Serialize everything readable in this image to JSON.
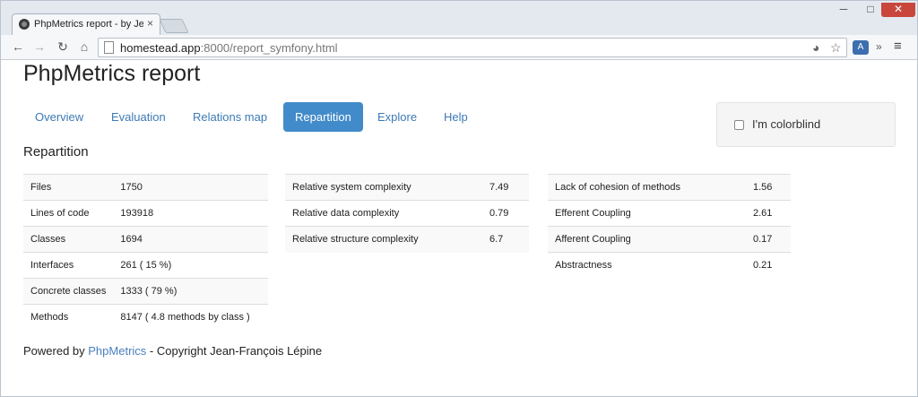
{
  "browser": {
    "tab_title": "PhpMetrics report - by Jean",
    "tab_close": "×",
    "url_host": "homestead.app",
    "url_rest": ":8000/report_symfony.html",
    "window_controls": {
      "minimize": "─",
      "maximize": "□",
      "close": "✕"
    },
    "icons": {
      "back": "←",
      "forward": "→",
      "reload": "↻",
      "home": "⌂",
      "star": "☆",
      "overflow": "»",
      "menu": "≡",
      "extension": "A",
      "reddit": "◕"
    }
  },
  "page": {
    "title": "PhpMetrics report",
    "nav": [
      {
        "label": "Overview",
        "active": false
      },
      {
        "label": "Evaluation",
        "active": false
      },
      {
        "label": "Relations map",
        "active": false
      },
      {
        "label": "Repartition",
        "active": true
      },
      {
        "label": "Explore",
        "active": false
      },
      {
        "label": "Help",
        "active": false
      }
    ],
    "colorblind_label": "I'm colorblind",
    "colorblind_checked": false,
    "section_title": "Repartition",
    "tables": [
      [
        [
          "Files",
          "1750"
        ],
        [
          "Lines of code",
          "193918"
        ],
        [
          "Classes",
          "1694"
        ],
        [
          "Interfaces",
          "261 ( 15 %)"
        ],
        [
          "Concrete classes",
          "1333 ( 79 %)"
        ],
        [
          "Methods",
          "8147 ( 4.8 methods by class )"
        ]
      ],
      [
        [
          "Relative system complexity",
          "7.49"
        ],
        [
          "Relative data complexity",
          "0.79"
        ],
        [
          "Relative structure complexity",
          "6.7"
        ]
      ],
      [
        [
          "Lack of cohesion of methods",
          "1.56"
        ],
        [
          "Efferent Coupling",
          "2.61"
        ],
        [
          "Afferent Coupling",
          "0.17"
        ],
        [
          "Abstractness",
          "0.21"
        ]
      ]
    ],
    "footer": {
      "prefix": "Powered by ",
      "link": "PhpMetrics",
      "suffix": " - Copyright Jean-François Lépine"
    }
  }
}
